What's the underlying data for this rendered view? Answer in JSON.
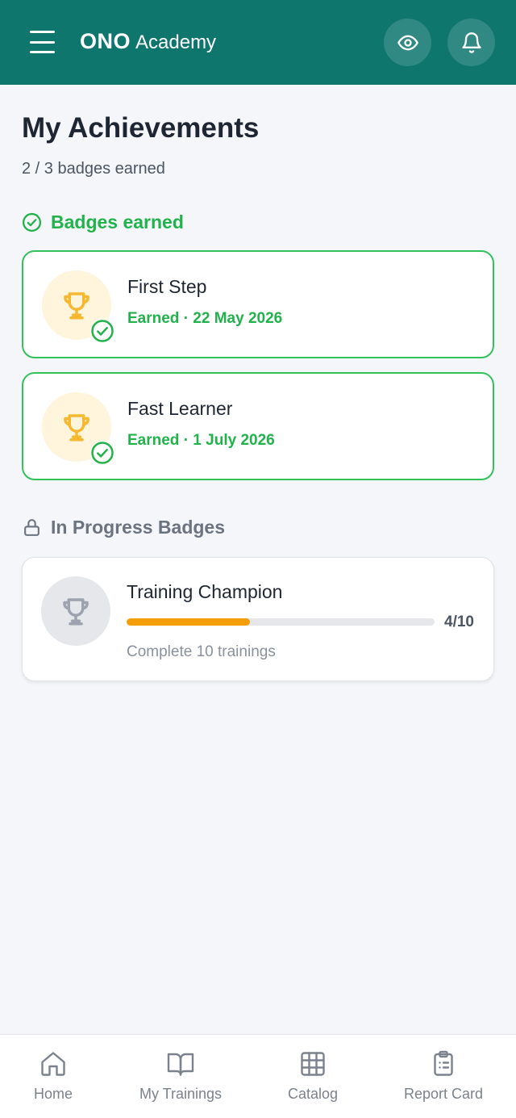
{
  "header": {
    "brand_bold": "ONO",
    "brand_light": "Academy",
    "icons": [
      "menu-icon",
      "eye-icon",
      "bell-icon"
    ],
    "color": "#0f766e"
  },
  "page": {
    "title": "My Achievements",
    "subtitle": "2 / 3 badges earned"
  },
  "earned_section": {
    "label": "Badges earned",
    "badges": [
      {
        "name": "First Step",
        "date": "Earned · 22 May 2026"
      },
      {
        "name": "Fast Learner",
        "date": "Earned · 1 July 2026"
      }
    ]
  },
  "progress_section": {
    "label": "In Progress Badges",
    "badges": [
      {
        "name": "Training Champion",
        "count": "4/10",
        "progress": 0.4,
        "description": "Complete 10 trainings"
      }
    ]
  },
  "nav": {
    "items": [
      {
        "label": "Home",
        "icon": "home-icon"
      },
      {
        "label": "My Trainings",
        "icon": "book-icon"
      },
      {
        "label": "Catalog",
        "icon": "grid-icon"
      },
      {
        "label": "Report Card",
        "icon": "clipboard-icon"
      }
    ]
  },
  "colors": {
    "accent_green": "#22b24c",
    "gold": "#f5b82e",
    "progress": "#f59e0b"
  }
}
